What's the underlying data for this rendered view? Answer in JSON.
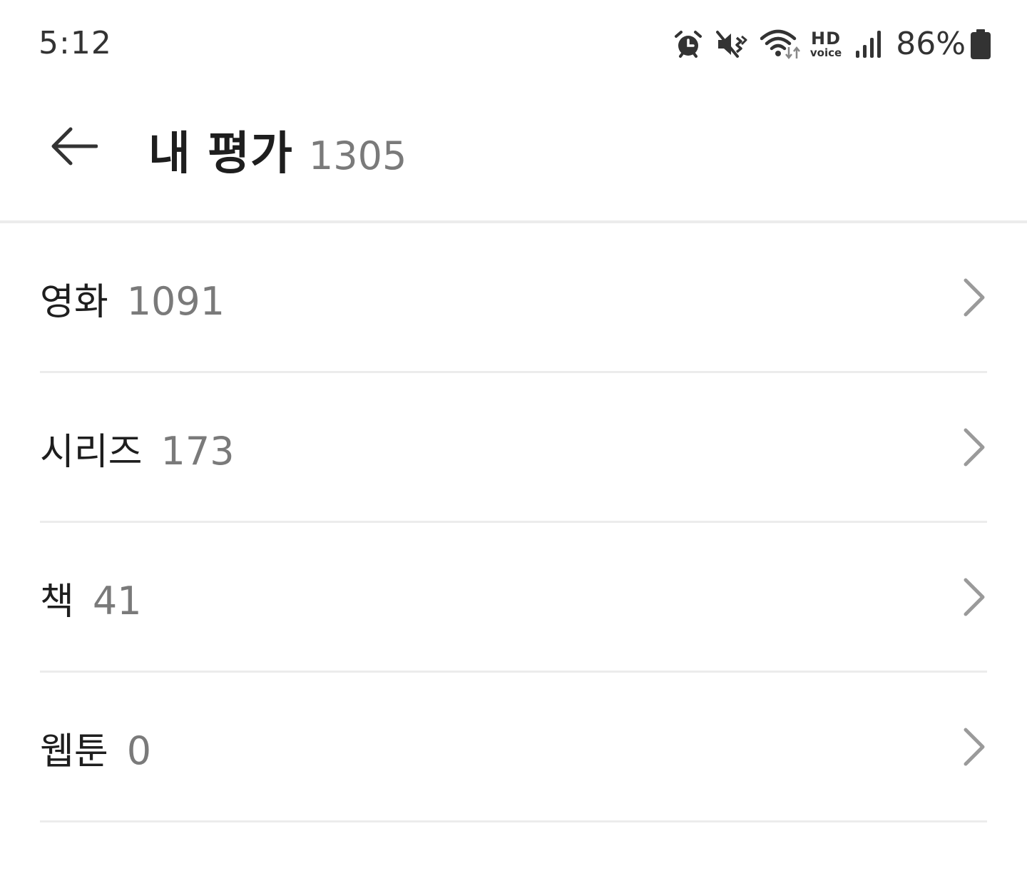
{
  "status_bar": {
    "time": "5:12",
    "icons": [
      "alarm-icon",
      "mute-icon",
      "wifi-icon",
      "hd-voice-icon",
      "signal-icon",
      "battery-icon"
    ],
    "hd_label": "HD",
    "voice_label": "voice",
    "battery_percent": "86%"
  },
  "header": {
    "back_icon": "arrow-left-icon",
    "title": "내 평가",
    "total_count": "1305"
  },
  "categories": [
    {
      "name": "영화",
      "count": "1091"
    },
    {
      "name": "시리즈",
      "count": "173"
    },
    {
      "name": "책",
      "count": "41"
    },
    {
      "name": "웹툰",
      "count": "0"
    }
  ],
  "colors": {
    "background": "#ffffff",
    "primary_text": "#1e1e1e",
    "secondary_text": "#7a7a7a",
    "divider": "#ececec",
    "chevron": "#9a9a9a"
  }
}
